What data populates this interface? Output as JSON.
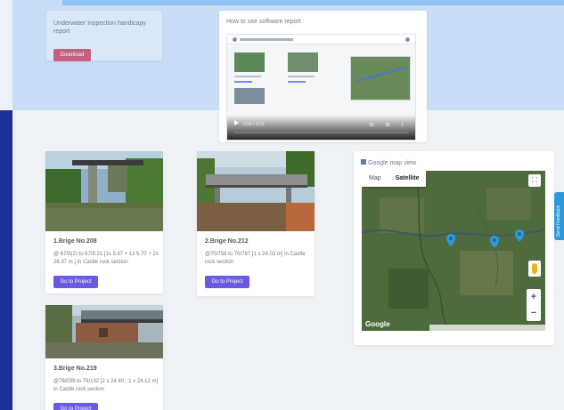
{
  "report_card": {
    "title": "Underwater Inspection handicapy report",
    "download_label": "Download"
  },
  "video_card": {
    "title": "How to use software report",
    "time": "0:00 / 3:16"
  },
  "bridges": [
    {
      "name": "1.Brige No.208",
      "detail": "@ 67/5(2) to 67/9.21 [1x 5.67 + 1x 5.70 + 2x 26.37 m ] in Castle rock section",
      "button": "Go to Project"
    },
    {
      "name": "2.Brige No.212",
      "detail": "@70/758 to 70/787 [1 x 24.03 m] in Castle rock section",
      "button": "Go to Project"
    },
    {
      "name": "3.Brige No.219",
      "detail": "@76/039 to 76/132 [2 x 24.40 , 1 x 24.12 m] in Castle rock section",
      "button": "Go to Project"
    }
  ],
  "map_card": {
    "title": "Google map view",
    "tab_map": "Map",
    "tab_satellite": "Satellite",
    "logo": "Google",
    "zoom_in": "+",
    "zoom_out": "−",
    "fullscreen": "⛶"
  },
  "feedback": {
    "label": "Send Feedback"
  },
  "colors": {
    "accent_button": "#6a5ae0",
    "download_button": "#c46080",
    "sidebar": "#1e2f96",
    "marker": "#2a9ad8",
    "feedback": "#2c9ad9"
  }
}
